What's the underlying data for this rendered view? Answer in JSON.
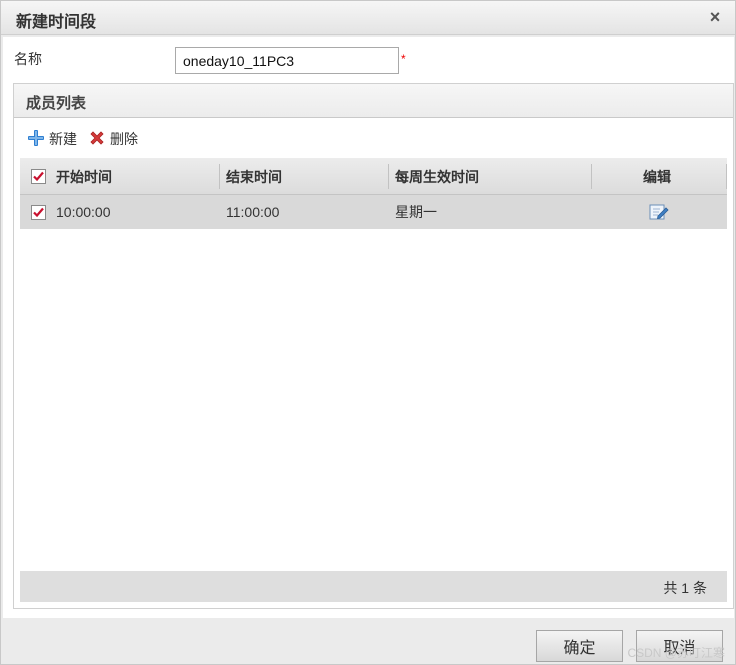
{
  "dialog": {
    "title": "新建时间段",
    "close_glyph": "×"
  },
  "form": {
    "name_label": "名称",
    "name_value": "oneday10_11PC3",
    "required_mark": "*"
  },
  "panel": {
    "title": "成员列表",
    "toolbar": {
      "new_label": "新建",
      "delete_label": "删除"
    },
    "columns": {
      "start": "开始时间",
      "end": "结束时间",
      "weekday": "每周生效时间",
      "edit": "编辑"
    },
    "rows": [
      {
        "start": "10:00:00",
        "end": "11:00:00",
        "weekday": "星期一",
        "checked": true
      }
    ],
    "footer_count": "共 1 条"
  },
  "buttons": {
    "ok": "确定",
    "cancel": "取消"
  },
  "watermark": "CSDN @苏叮江寒",
  "icons": {
    "close": "close-icon",
    "add": "plus-icon",
    "delete": "delete-x-icon",
    "edit": "edit-icon",
    "checkbox": "checkbox-checked-icon"
  },
  "colors": {
    "accent_blue": "#2f7fd1",
    "delete_red": "#d43b3b",
    "required_red": "#e00000",
    "check_red": "#c8102e"
  }
}
